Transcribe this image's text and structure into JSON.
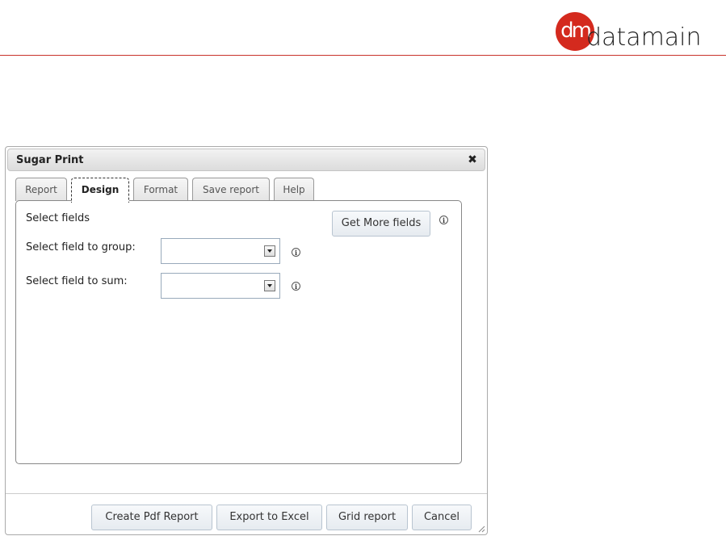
{
  "brand": {
    "mark": "dm",
    "name": "datamain",
    "accent": "#d42a1e"
  },
  "dialog": {
    "title": "Sugar Print",
    "close_icon": "close-icon"
  },
  "tabs": [
    {
      "label": "Report",
      "active": false
    },
    {
      "label": "Design",
      "active": true
    },
    {
      "label": "Format",
      "active": false
    },
    {
      "label": "Save report",
      "active": false
    },
    {
      "label": "Help",
      "active": false
    }
  ],
  "design": {
    "select_fields_label": "Select fields",
    "get_more_fields_label": "Get More fields",
    "group_label": "Select field to group:",
    "group_value": "",
    "sum_label": "Select field to sum:",
    "sum_value": "",
    "info_glyph": "i"
  },
  "footer": {
    "buttons": [
      "Create Pdf Report",
      "Export to Excel",
      "Grid report",
      "Cancel"
    ]
  }
}
